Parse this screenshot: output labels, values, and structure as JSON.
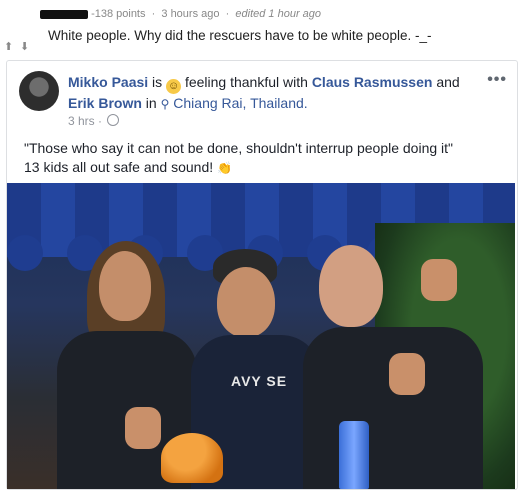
{
  "comment": {
    "points": "-138 points",
    "time": "3 hours ago",
    "edited": "edited 1 hour ago",
    "text": "White people. Why did the rescuers have to be white people. -_-"
  },
  "post": {
    "author": "Mikko Paasi",
    "is_word": "is",
    "feeling_text": "feeling thankful with",
    "tagged_1": "Claus Rasmussen",
    "and_word": "and",
    "tagged_2": "Erik Brown",
    "in_word": "in",
    "location": "Chiang Rai, Thailand.",
    "time": "3 hrs",
    "quote": "\"Those who say it can not be done, shouldn't interrup people doing it\"",
    "line2": "13 kids all out safe and sound!",
    "icons": [
      "smile-emoji",
      "location-pin",
      "globe",
      "clap-emoji",
      "more-options"
    ]
  },
  "photo": {
    "shirt_text": "AVY SE",
    "colors": {
      "awning": "#1e3a8a",
      "helmet": "#e8891f",
      "bottle": "#4a7fe6"
    }
  }
}
